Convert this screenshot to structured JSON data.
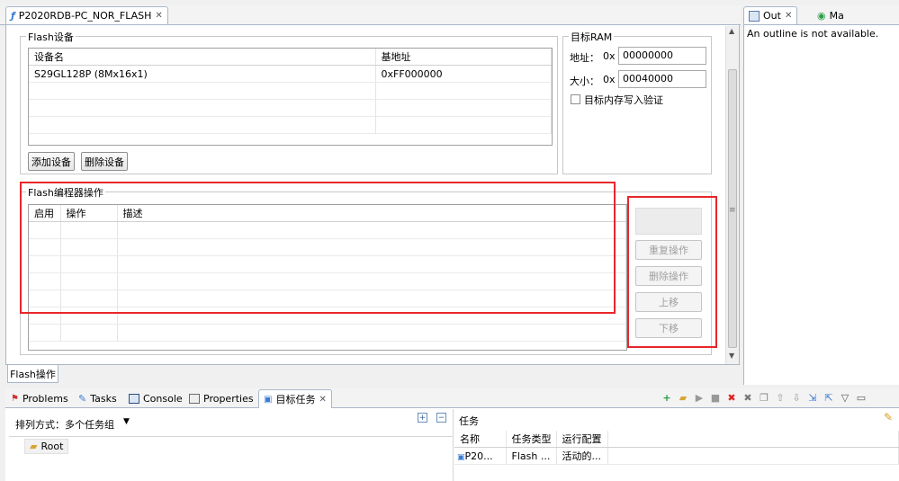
{
  "editor": {
    "tab_title": "P2020RDB-PC_NOR_FLASH",
    "bottom_tab": "Flash操作",
    "flash_devices": {
      "title": "Flash设备",
      "columns": [
        "设备名",
        "基地址"
      ],
      "rows": [
        [
          "S29GL128P (8Mx16x1)",
          "0xFF000000"
        ]
      ],
      "add_button": "添加设备",
      "remove_button": "删除设备"
    },
    "target_ram": {
      "title": "目标RAM",
      "address_label": "地址：",
      "address_prefix": "0x",
      "address_value": "00000000",
      "size_label": "大小：",
      "size_prefix": "0x",
      "size_value": "00040000",
      "verify_label": "目标内存写入验证",
      "verify_checked": false
    },
    "programmer_ops": {
      "title": "Flash编程器操作",
      "columns": [
        "启用",
        "操作",
        "描述"
      ],
      "repeat_button": "重复操作",
      "delete_button": "删除操作",
      "up_button": "上移",
      "down_button": "下移"
    }
  },
  "outline": {
    "tab_out": "Out",
    "tab_ma": "Ma",
    "message": "An outline is not available."
  },
  "bottom_panel": {
    "tabs": [
      "Problems",
      "Tasks",
      "Console",
      "Properties",
      "目标任务"
    ],
    "sort_label": "排列方式：多个任务组",
    "tree_root": "Root",
    "tasks_title": "任务",
    "task_columns": [
      "名称",
      "任务类型",
      "运行配置"
    ],
    "task_rows": [
      [
        "P20...",
        "Flash ...",
        "活动的..."
      ]
    ]
  },
  "colors": {
    "highlight_red": "#e8262a",
    "tab_border": "#a9b7c9"
  }
}
